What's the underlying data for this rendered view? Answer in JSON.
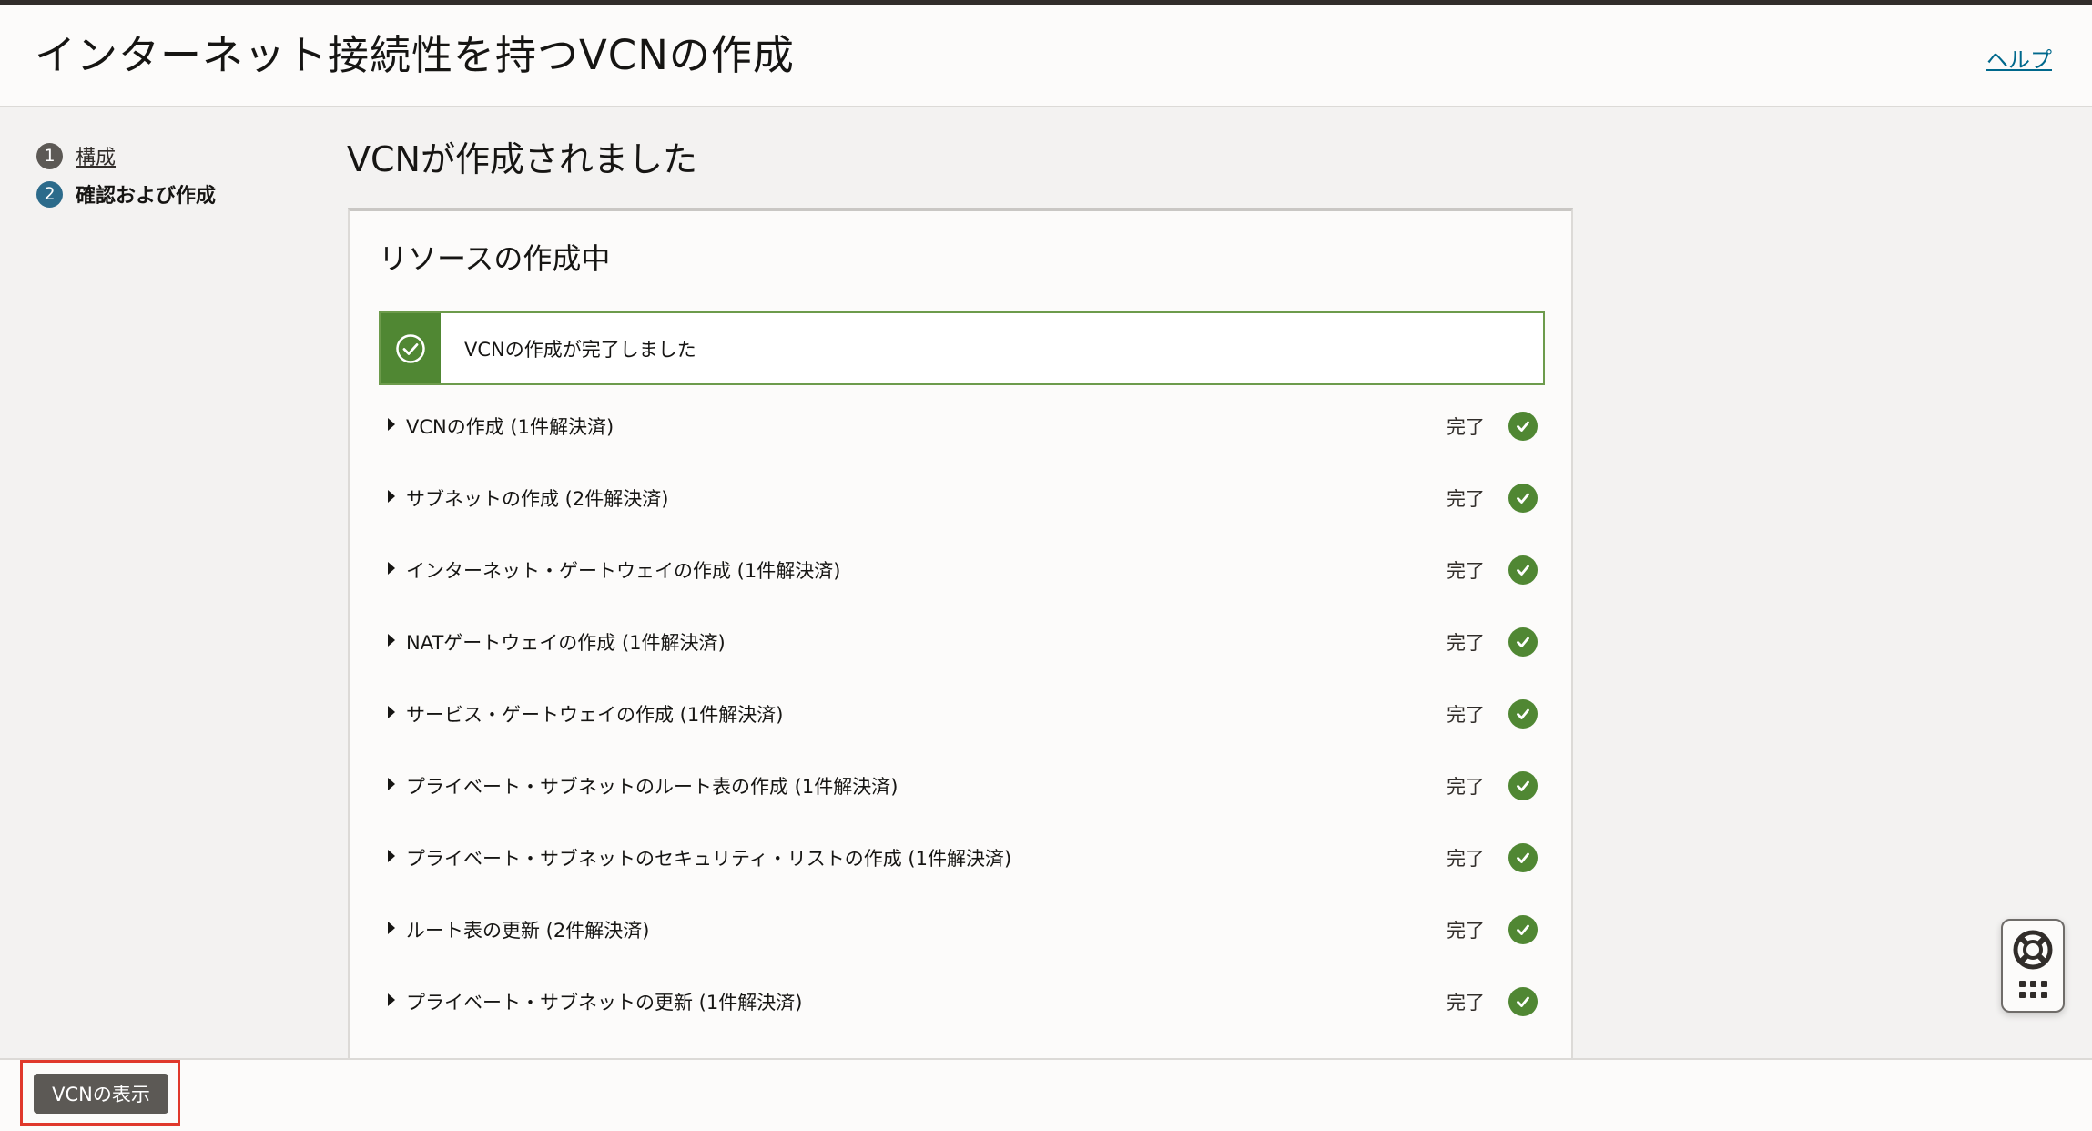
{
  "header": {
    "title": "インターネット接続性を持つVCNの作成",
    "help_label": "ヘルプ"
  },
  "steps": [
    {
      "number": "1",
      "label": "構成",
      "state": "link"
    },
    {
      "number": "2",
      "label": "確認および作成",
      "state": "current"
    }
  ],
  "main": {
    "heading": "VCNが作成されました",
    "card_title": "リソースの作成中",
    "banner_text": "VCNの作成が完了しました",
    "tasks": [
      {
        "label": "VCNの作成 (1件解決済)",
        "status": "完了"
      },
      {
        "label": "サブネットの作成 (2件解決済)",
        "status": "完了"
      },
      {
        "label": "インターネット・ゲートウェイの作成 (1件解決済)",
        "status": "完了"
      },
      {
        "label": "NATゲートウェイの作成 (1件解決済)",
        "status": "完了"
      },
      {
        "label": "サービス・ゲートウェイの作成 (1件解決済)",
        "status": "完了"
      },
      {
        "label": "プライベート・サブネットのルート表の作成 (1件解決済)",
        "status": "完了"
      },
      {
        "label": "プライベート・サブネットのセキュリティ・リストの作成 (1件解決済)",
        "status": "完了"
      },
      {
        "label": "ルート表の更新 (2件解決済)",
        "status": "完了"
      },
      {
        "label": "プライベート・サブネットの更新 (1件解決済)",
        "status": "完了"
      }
    ]
  },
  "footer": {
    "view_button_label": "VCNの表示"
  },
  "icons": {
    "banner": "check-circle-outline-icon",
    "task_status": "check-circle-icon",
    "expand": "caret-right-icon",
    "help_widget": [
      "lifebuoy-icon",
      "grid-icon"
    ]
  },
  "colors": {
    "success": "#508733",
    "accent_link": "#00688c",
    "highlight": "#e0382b"
  }
}
